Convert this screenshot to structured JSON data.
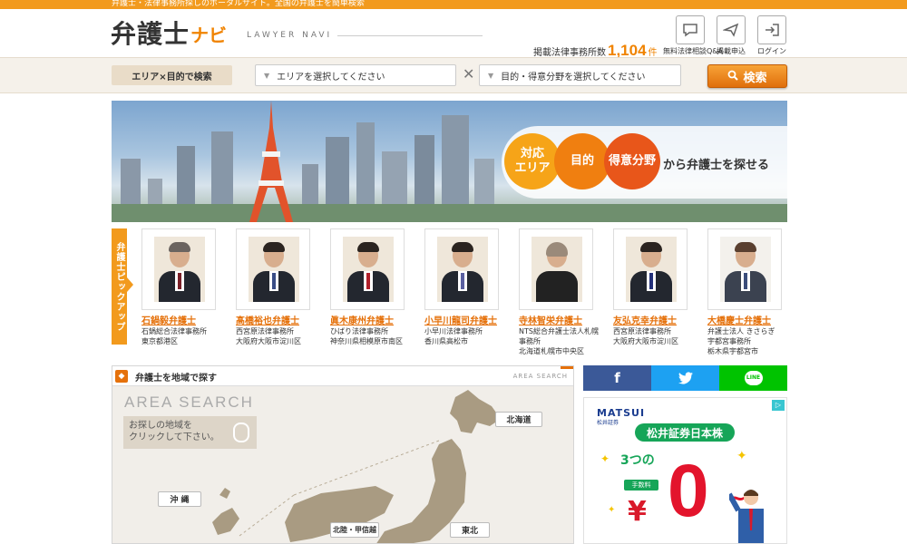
{
  "topbar": {
    "tagline": "弁護士・法律事務所探しのポータルサイト。全国の弁護士を簡単検索"
  },
  "header": {
    "logo_main": "弁護士",
    "logo_navi": "ナビ",
    "logo_sub": "LAWYER NAVI",
    "count_label": "掲載法律事務所数",
    "count_value": "1,104",
    "count_unit": "件",
    "icons": [
      {
        "name": "chat-icon",
        "glyph": "▭",
        "label": "無料法律相談Q&A"
      },
      {
        "name": "paper-plane-icon",
        "glyph": "✈",
        "label": "掲載申込"
      },
      {
        "name": "login-icon",
        "glyph": "⇥",
        "label": "ログイン"
      }
    ]
  },
  "search": {
    "label": "エリア×目的で検索",
    "area_placeholder": "エリアを選択してください",
    "purpose_placeholder": "目的・得意分野を選択してください",
    "separator": "✕",
    "button": "検索"
  },
  "hero": {
    "circle1": "対応\nエリア",
    "circle2": "目的",
    "circle3": "得意分野",
    "tail": "から弁護士を探せる",
    "colors": {
      "c1": "#f6a418",
      "c2": "#f07f10",
      "c3": "#e8561a"
    }
  },
  "pickup": {
    "tab": "弁護士ピックアップ",
    "lawyers": [
      {
        "name": "石鍋毅弁護士",
        "info1": "石鍋総合法律事務所",
        "info2": "東京都港区",
        "info3": ""
      },
      {
        "name": "髙橋裕也弁護士",
        "info1": "西宮原法律事務所",
        "info2": "大阪府大阪市淀川区",
        "info3": ""
      },
      {
        "name": "眞木康州弁護士",
        "info1": "ひばり法律事務所",
        "info2": "神奈川県相模原市南区",
        "info3": ""
      },
      {
        "name": "小早川龍司弁護士",
        "info1": "小早川法律事務所",
        "info2": "香川県高松市",
        "info3": ""
      },
      {
        "name": "寺林智栄弁護士",
        "info1": "NTS総合弁護士法人札幌",
        "info2": "事務所",
        "info3": "北海道札幌市中央区"
      },
      {
        "name": "友弘克幸弁護士",
        "info1": "西宮原法律事務所",
        "info2": "大阪府大阪市淀川区",
        "info3": ""
      },
      {
        "name": "大橋慶士弁護士",
        "info1": "弁護士法人 きさらぎ",
        "info2": "宇都宮事務所",
        "info3": "栃木県宇都宮市"
      }
    ]
  },
  "area": {
    "heading": "弁護士を地域で探す",
    "heading_right": "AREA SEARCH",
    "title": "AREA SEARCH",
    "hint1": "お探しの地域を",
    "hint2": "クリックして下さい。",
    "regions": {
      "hokkaido": "北海道",
      "okinawa": "沖 縄",
      "hokuriku": "北陸・甲信越",
      "tohoku": "東北"
    }
  },
  "social": {
    "facebook": "f",
    "twitter": "🐦",
    "line": "LINE"
  },
  "ad": {
    "brand": "MATSUI",
    "brand_sub": "松井証券",
    "title": "松井証券日本株",
    "three": "3つの",
    "fee": "手数料",
    "yen": "¥",
    "zero": "0",
    "tilde": "~"
  }
}
